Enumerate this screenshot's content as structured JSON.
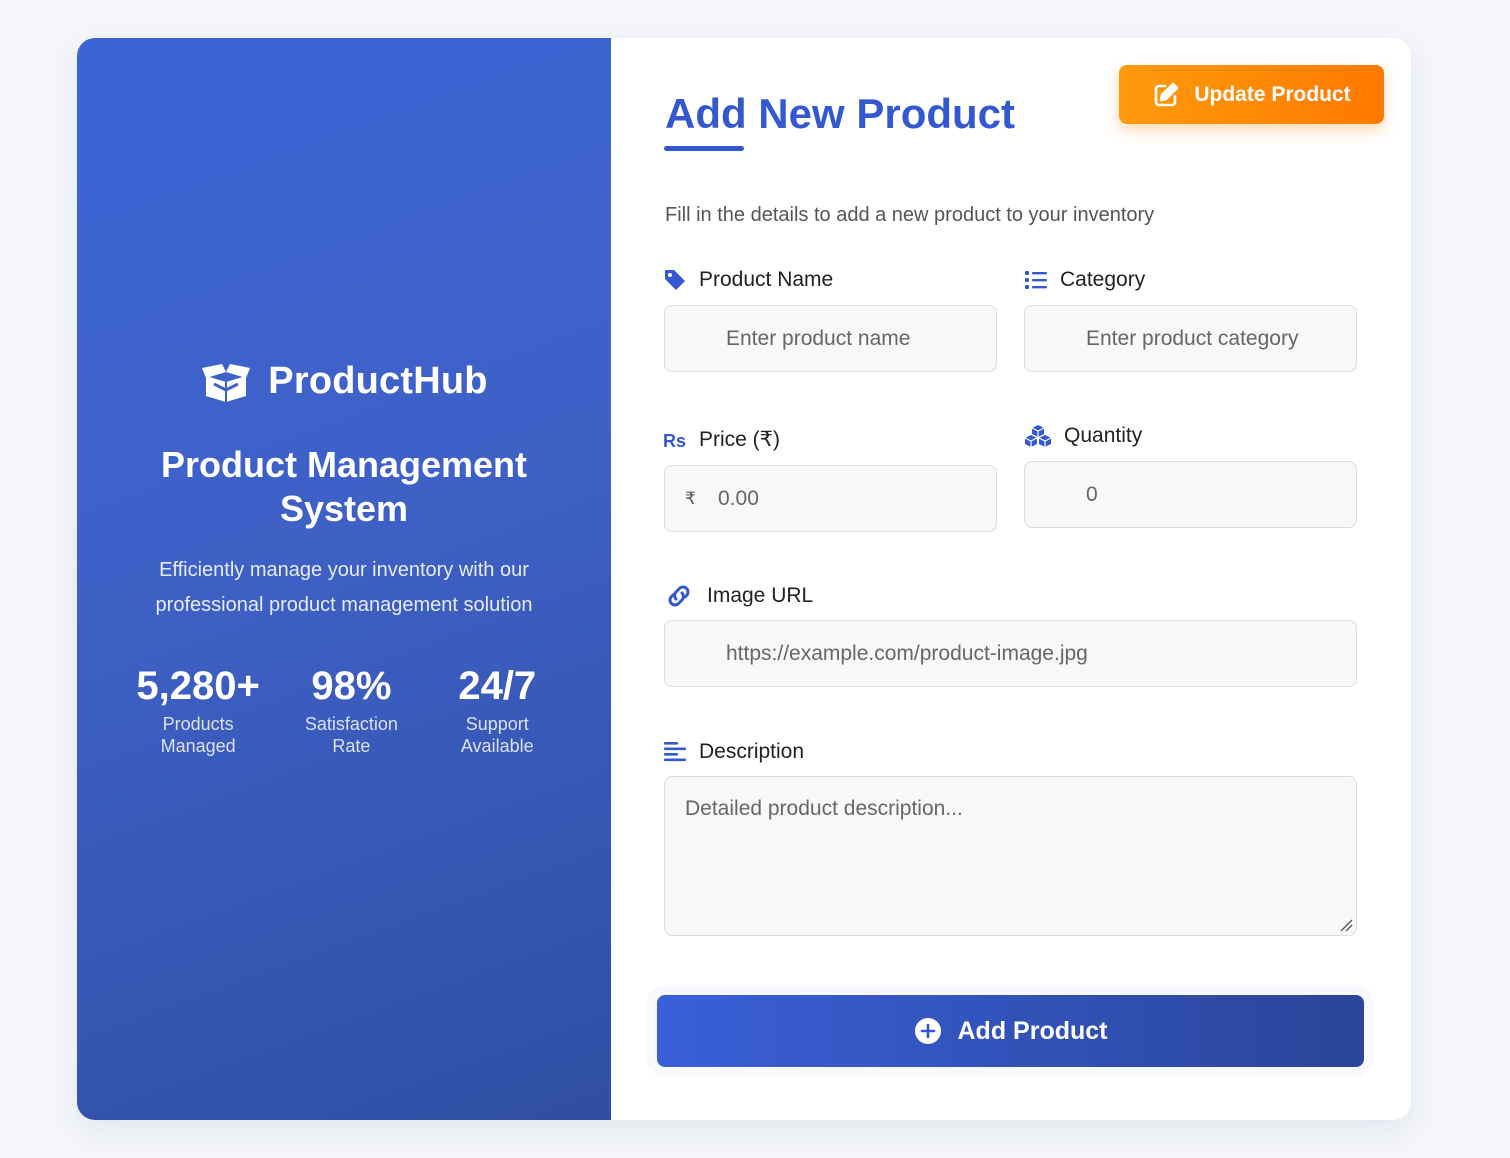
{
  "brand": {
    "name": "ProductHub",
    "icon": "open-box-icon"
  },
  "hero": {
    "title": "Product Management System",
    "description": "Efficiently manage your inventory with our professional product management solution"
  },
  "stats": [
    {
      "value": "5,280+",
      "label": "Products Managed"
    },
    {
      "value": "98%",
      "label": "Satisfaction Rate"
    },
    {
      "value": "24/7",
      "label": "Support Available"
    }
  ],
  "form": {
    "title": "Add New Product",
    "subtitle": "Fill in the details to add a new product to your inventory",
    "update_button": "Update Product",
    "product_name": {
      "label": "Product Name",
      "placeholder": "Enter product name",
      "icon": "tag-icon"
    },
    "category": {
      "label": "Category",
      "placeholder": "Enter product category",
      "icon": "list-icon"
    },
    "price": {
      "label": "Price (₹)",
      "placeholder": "0.00",
      "prefix": "₹",
      "icon": "rupee-icon"
    },
    "quantity": {
      "label": "Quantity",
      "placeholder": "0",
      "icon": "cubes-icon"
    },
    "image_url": {
      "label": "Image URL",
      "placeholder": "https://example.com/product-image.jpg",
      "icon": "link-icon"
    },
    "description": {
      "label": "Description",
      "placeholder": "Detailed product description...",
      "icon": "align-left-icon"
    },
    "submit_button": "Add Product"
  },
  "colors": {
    "primary": "#3458cf",
    "accent": "#ff8a00",
    "panel_gradient_start": "#3a63d6",
    "panel_gradient_end": "#2f4ea3"
  }
}
